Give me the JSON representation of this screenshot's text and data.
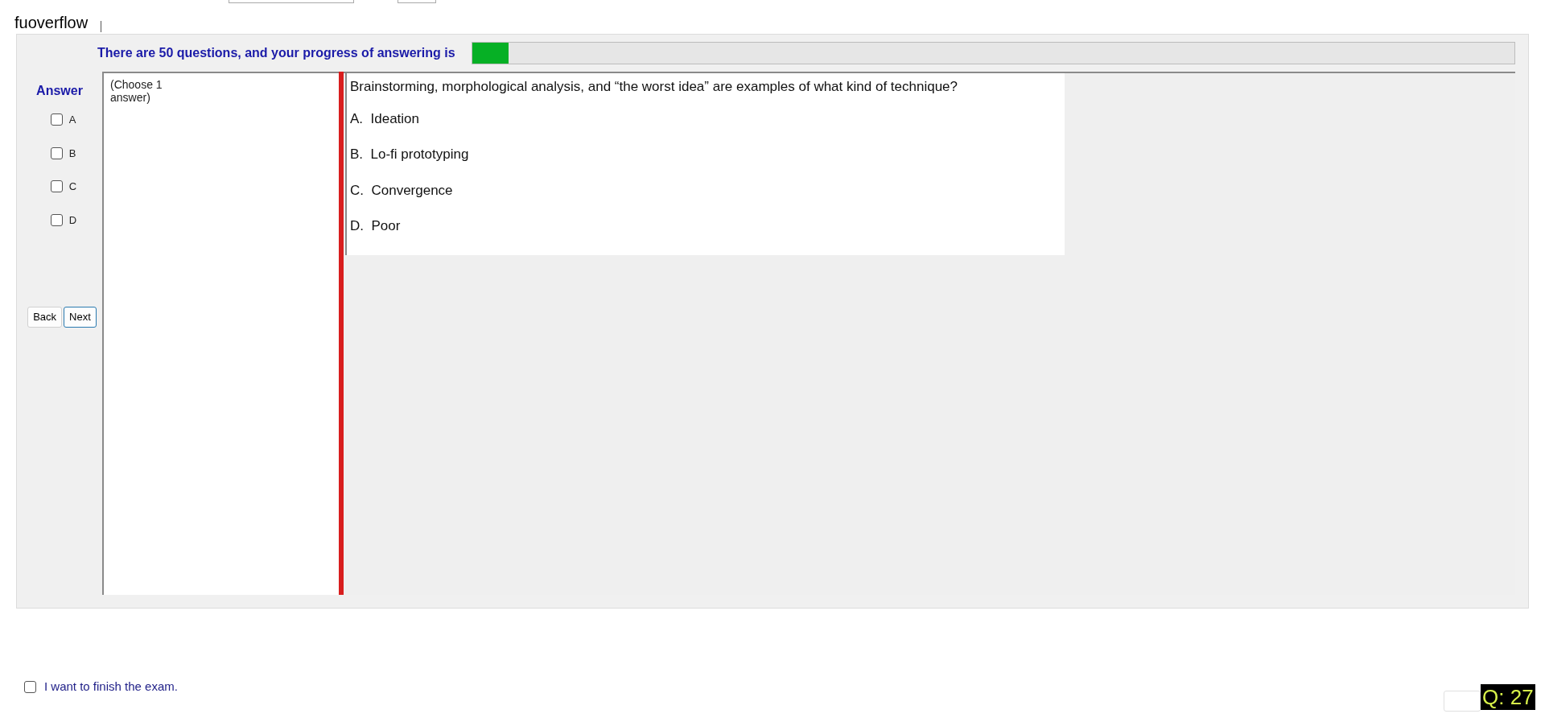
{
  "site_label": "fuoverflow",
  "progress": {
    "label": "There are 50 questions, and your progress of answering is",
    "level": 0.035
  },
  "answer_panel": {
    "title": "Answer",
    "options": [
      {
        "label": "A",
        "checked": false
      },
      {
        "label": "B",
        "checked": false
      },
      {
        "label": "C",
        "checked": false
      },
      {
        "label": "D",
        "checked": false
      }
    ],
    "buttons": [
      {
        "label": "Back",
        "focused": false
      },
      {
        "label": "Next",
        "focused": true
      }
    ]
  },
  "instruction": "(Choose 1 answer)",
  "question": {
    "text": "Brainstorming, morphological analysis, and “the worst idea” are examples of what kind of technique?",
    "choices": [
      "A.  Ideation",
      "B.  Lo-fi prototyping",
      "C.  Convergence",
      "D.  Poor"
    ]
  },
  "finish": {
    "label": "I want to finish the exam.",
    "checked": false
  },
  "question_number": "Q: 27"
}
